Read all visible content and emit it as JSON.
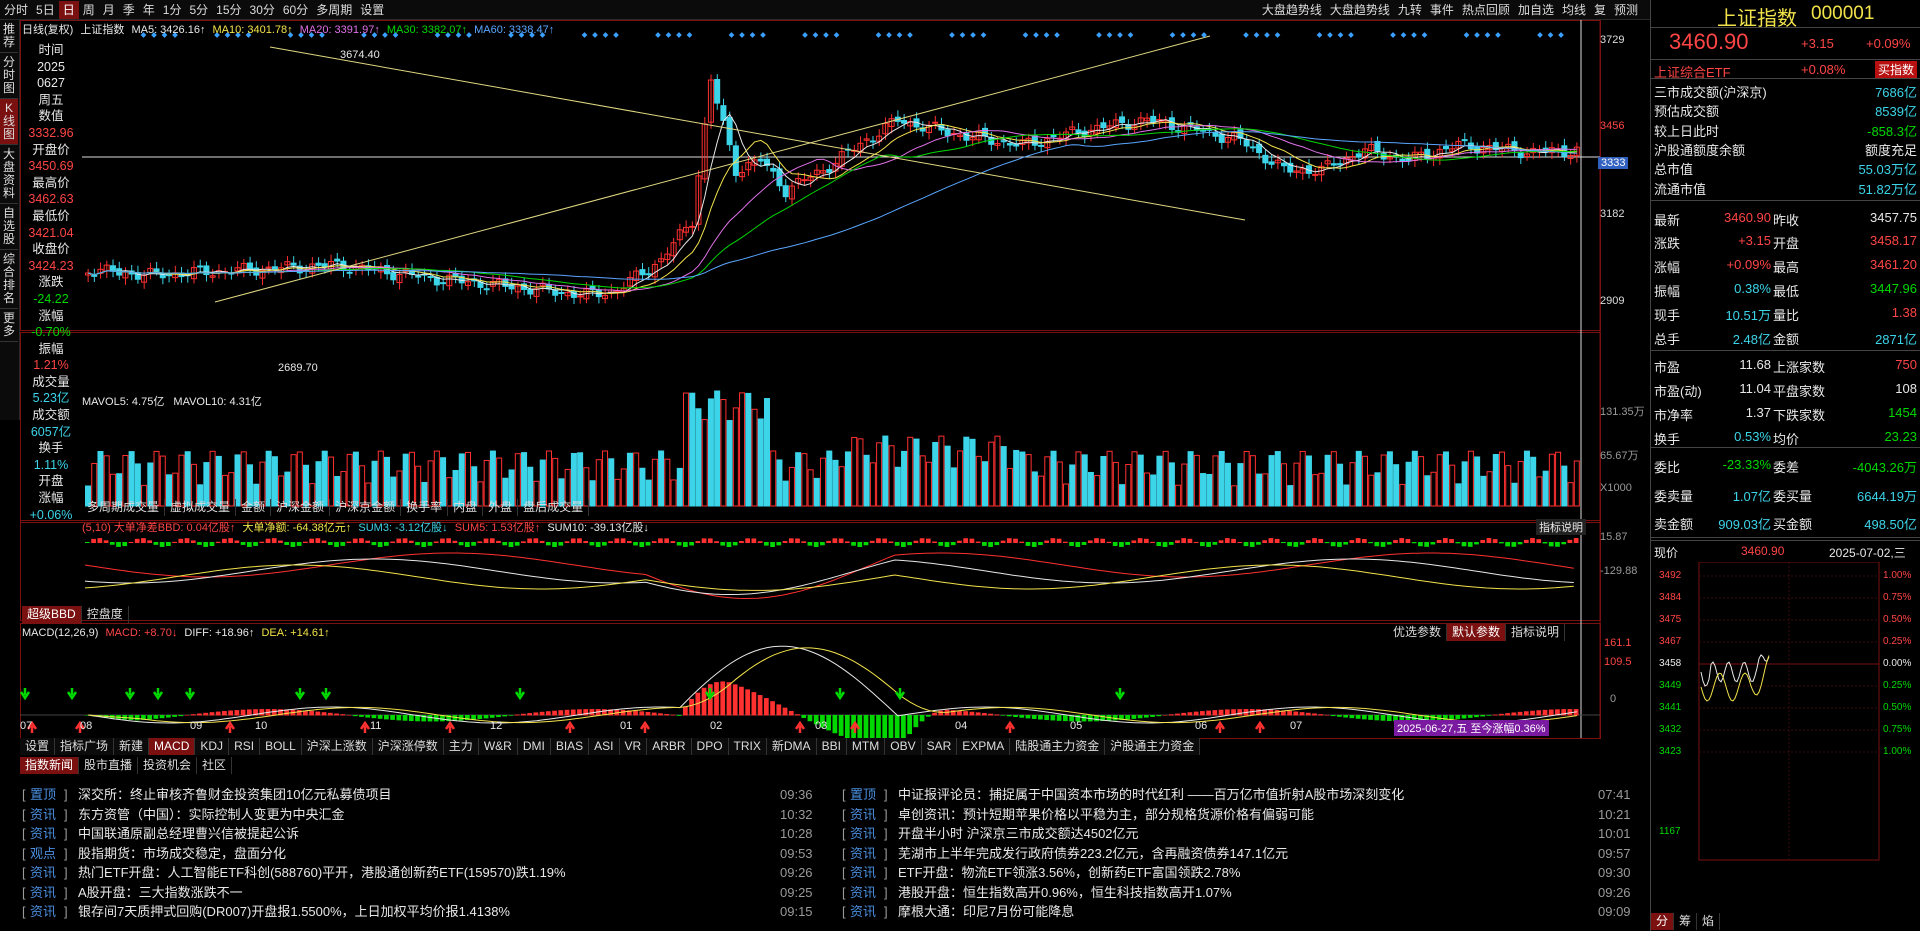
{
  "topbar": {
    "periods": [
      "分时",
      "5日",
      "日",
      "周",
      "月",
      "季",
      "年",
      "1分",
      "5分",
      "15分",
      "30分",
      "60分",
      "多周期",
      "设置"
    ],
    "selected": "日",
    "right_buttons": [
      "大盘趋势线",
      "大盘趋势线",
      "九转",
      "事件",
      "热点回顾",
      "加自选",
      "均线",
      "复",
      "预测"
    ]
  },
  "leftnav": [
    "推荐",
    "分时图",
    "K线图",
    "大盘资料",
    "自选股",
    "综合排名",
    "更多"
  ],
  "legend": {
    "label": "日线(复权)",
    "name": "上证指数",
    "ma5": "MA5: 3426.16↑",
    "ma10": "MA10: 3401.78↑",
    "ma20": "MA20: 3391.97↑",
    "ma30": "MA30: 3382.07↑",
    "ma60": "MA60: 3338.47↑"
  },
  "infopanel": [
    {
      "k": "时间",
      "v": "2025"
    },
    {
      "k": "",
      "v": "0627"
    },
    {
      "k": "周五",
      "v": ""
    },
    {
      "k": "数值",
      "v": "3332.96"
    },
    {
      "k": "开盘价",
      "v": "3450.69"
    },
    {
      "k": "最高价",
      "v": "3462.63"
    },
    {
      "k": "最低价",
      "v": "3421.04"
    },
    {
      "k": "收盘价",
      "v": "3424.23"
    },
    {
      "k": "涨跌",
      "v": "-24.22"
    },
    {
      "k": "涨幅",
      "v": "-0.70%"
    },
    {
      "k": "振幅",
      "v": "1.21%"
    },
    {
      "k": "成交量",
      "v": "5.23亿"
    },
    {
      "k": "成交额",
      "v": "6057亿"
    },
    {
      "k": "换手",
      "v": "1.11%"
    },
    {
      "k": "开盘",
      "v": ""
    },
    {
      "k": "涨幅",
      "v": "+0.06%"
    }
  ],
  "price_axis": [
    "3729",
    "3456",
    "3333",
    "3182",
    "2909"
  ],
  "annotations": {
    "high": "3674.40",
    "low": "2689.70"
  },
  "volume": {
    "legend_ma5": "MAVOL5: 4.75亿",
    "legend_ma10": "MAVOL10: 4.31亿",
    "axis": [
      "131.35万",
      "65.67万",
      "X1000"
    ],
    "tabs": [
      "多周期成交量",
      "虚拟成交量",
      "金额",
      "沪深金额",
      "沪深京金额",
      "换手率",
      "内盘",
      "外盘",
      "盘后成交量"
    ]
  },
  "bbd": {
    "legend": "(5,10) 大单净差BBD: 0.04亿股↑",
    "l2": "大单净额: -64.38亿元↑",
    "l3": "SUM3: -3.12亿股↓",
    "l4": "SUM5: 1.53亿股↑",
    "l5": "SUM10: -39.13亿股↓",
    "help": "指标说明",
    "axis": [
      "15.87",
      "-129.88"
    ],
    "tabs": [
      "超级BBD",
      "控盘度"
    ]
  },
  "macd": {
    "legend": "MACD(12,26,9)",
    "macd": "MACD: +8.70↓",
    "diff": "DIFF: +18.96↑",
    "dea": "DEA: +14.61↑",
    "buttons": [
      "优选参数",
      "默认参数",
      "指标说明"
    ],
    "axis": [
      "161.1",
      "109.5",
      "0"
    ]
  },
  "date_axis": [
    "07",
    "08",
    "09",
    "10",
    "11",
    "12",
    "01",
    "02",
    "03",
    "04",
    "05",
    "06",
    "07"
  ],
  "date_highlight": "2025-06-27,五 至今涨幅0.36%",
  "indicator_tabs": [
    "设置",
    "指标广场",
    "新建",
    "MACD",
    "KDJ",
    "RSI",
    "BOLL",
    "沪深上涨数",
    "沪深涨停数",
    "主力",
    "W&R",
    "DMI",
    "BIAS",
    "ASI",
    "VR",
    "ARBR",
    "DPO",
    "TRIX",
    "新DMA",
    "BBI",
    "MTM",
    "OBV",
    "SAR",
    "EXPMA",
    "陆股通主力资金",
    "沪股通主力资金"
  ],
  "news_tabs": [
    "指数新闻",
    "股市直播",
    "投资机会",
    "社区"
  ],
  "news_left": [
    {
      "tag": "置顶",
      "text": "深交所：终止审核齐鲁财金投资集团10亿元私募债项目",
      "time": "09:36"
    },
    {
      "tag": "资讯",
      "text": "东方资管（中国）：实际控制人变更为中央汇金",
      "time": "10:32"
    },
    {
      "tag": "资讯",
      "text": "中国联通原副总经理曹兴信被提起公诉",
      "time": "10:28"
    },
    {
      "tag": "观点",
      "text": "股指期货：市场成交稳定，盘面分化",
      "time": "09:53"
    },
    {
      "tag": "资讯",
      "text": "热门ETF开盘：人工智能ETF科创(588760)平开，港股通创新药ETF(159570)跌1.19%",
      "time": "09:26"
    },
    {
      "tag": "资讯",
      "text": "A股开盘：三大指数涨跌不一",
      "time": "09:25"
    },
    {
      "tag": "资讯",
      "text": "银存间7天质押式回购(DR007)开盘报1.5500%，上日加权平均价报1.4138%",
      "time": "09:15"
    }
  ],
  "news_right": [
    {
      "tag": "置顶",
      "text": "中证报评论员：捕捉属于中国资本市场的时代红利 ——百万亿市值折射A股市场深刻变化",
      "time": "07:41"
    },
    {
      "tag": "资讯",
      "text": "卓创资讯：预计短期苹果价格以平稳为主，部分规格货源价格有偏弱可能",
      "time": "10:21"
    },
    {
      "tag": "资讯",
      "text": "开盘半小时 沪深京三市成交额达4502亿元",
      "time": "10:01"
    },
    {
      "tag": "资讯",
      "text": "芜湖市上半年完成发行政府债券223.2亿元，含再融资债券147.1亿元",
      "time": "09:57"
    },
    {
      "tag": "资讯",
      "text": "ETF开盘：物流ETF领涨3.56%，创新药ETF富国领跌2.78%",
      "time": "09:30"
    },
    {
      "tag": "资讯",
      "text": "港股开盘：恒生指数高开0.96%，恒生科技指数高开1.07%",
      "time": "09:26"
    },
    {
      "tag": "资讯",
      "text": "摩根大通：印尼7月份可能降息",
      "time": "09:09"
    }
  ],
  "right": {
    "title": "上证指数",
    "code": "000001",
    "price": "3460.90",
    "change": "+3.15",
    "pct": "+0.09%",
    "etf_name": "上证综合ETF",
    "etf_pct": "+0.08%",
    "buy_btn": "买指数",
    "stats1": [
      {
        "k": "三市成交额(沪深京)",
        "v": "7686亿"
      },
      {
        "k": "预估成交额",
        "v": "8539亿"
      },
      {
        "k": "较上日此时",
        "v": "-858.3亿"
      },
      {
        "k": "沪股通额度余额",
        "v": "额度充足"
      },
      {
        "k": "总市值",
        "v": "55.03万亿"
      },
      {
        "k": "流通市值",
        "v": "51.82万亿"
      }
    ],
    "grid": [
      [
        "最新",
        "3460.90",
        "昨收",
        "3457.75"
      ],
      [
        "涨跌",
        "+3.15",
        "开盘",
        "3458.17"
      ],
      [
        "涨幅",
        "+0.09%",
        "最高",
        "3461.20"
      ],
      [
        "振幅",
        "0.38%",
        "最低",
        "3447.96"
      ],
      [
        "现手",
        "10.51万",
        "量比",
        "1.38"
      ],
      [
        "总手",
        "2.48亿",
        "金额",
        "2871亿"
      ],
      [
        "市盈",
        "11.68",
        "上涨家数",
        "750"
      ],
      [
        "市盈(动)",
        "11.04",
        "平盘家数",
        "108"
      ],
      [
        "市净率",
        "1.37",
        "下跌家数",
        "1454"
      ],
      [
        "换手",
        "0.53%",
        "均价",
        "23.23"
      ],
      [
        "委比",
        "-23.33%",
        "委差",
        "-4043.26万"
      ],
      [
        "委卖量",
        "1.07亿",
        "委买量",
        "6644.19万"
      ],
      [
        "卖金额",
        "909.03亿",
        "买金额",
        "498.50亿"
      ]
    ],
    "now_label": "现价",
    "now_value": "3460.90",
    "now_date": "2025-07-02,三",
    "mini_left": [
      "3492",
      "3484",
      "3475",
      "3467",
      "3458",
      "3449",
      "3441",
      "3432",
      "3423",
      "1167"
    ],
    "mini_right": [
      "1.00%",
      "0.75%",
      "0.50%",
      "0.25%",
      "0.00%",
      "0.25%",
      "0.50%",
      "0.75%",
      "1.00%"
    ],
    "bottom_tabs": [
      "分",
      "筹",
      "焰"
    ]
  },
  "colors": {
    "up": "#ff3030",
    "down": "#3cd4e8",
    "bg": "#000000",
    "accent": "#7a1010"
  }
}
